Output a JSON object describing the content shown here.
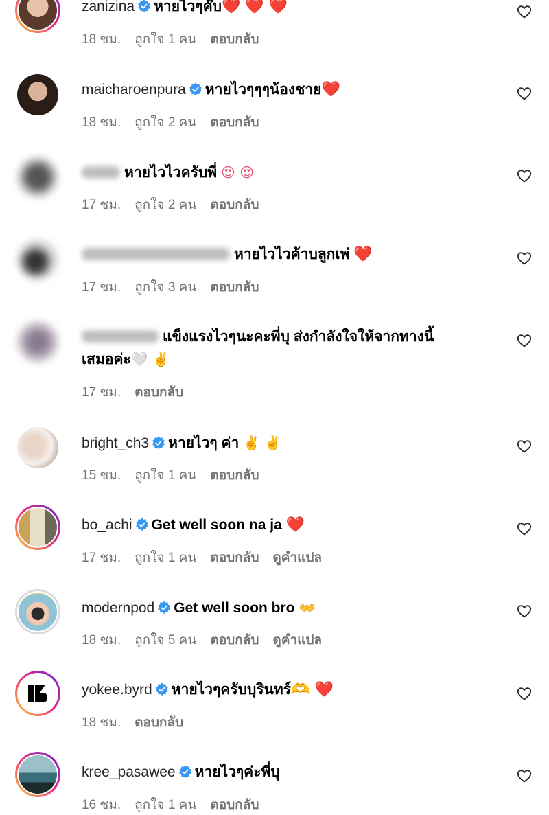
{
  "comments": [
    {
      "username": "zanizina",
      "text": "หายไวๆค๊บ",
      "emoji": "❤️ ❤️ ❤️",
      "time": "18 ชม.",
      "likes": "ถูกใจ 1 คน",
      "reply": "ตอบกลับ"
    },
    {
      "username": "maicharoenpura",
      "text": "หายไวๆๆๆน้องชาย",
      "emoji": "❤️",
      "time": "18 ชม.",
      "likes": "ถูกใจ 2 คน",
      "reply": "ตอบกลับ"
    },
    {
      "username": "",
      "text": "หายไวไวครับพี่",
      "emoji": "😍 😍",
      "time": "17 ชม.",
      "likes": "ถูกใจ 2 คน",
      "reply": "ตอบกลับ"
    },
    {
      "username": "",
      "text": "หายไวไวค้าบลูกเพ่",
      "emoji": "❤️",
      "time": "17 ชม.",
      "likes": "ถูกใจ 3 คน",
      "reply": "ตอบกลับ"
    },
    {
      "username": "",
      "text": "แข็งแรงไวๆนะคะพี่บุ ส่งกำลังใจให้จากทางนี้",
      "text2": "เสมอค่ะ",
      "emoji": "🤍 ✌️",
      "time": "17 ชม.",
      "reply": "ตอบกลับ"
    },
    {
      "username": "bright_ch3",
      "text": "หายไวๆ ค่า",
      "emoji": "✌️ ✌️",
      "time": "15 ชม.",
      "likes": "ถูกใจ 1 คน",
      "reply": "ตอบกลับ"
    },
    {
      "username": "bo_achi",
      "text": "Get well soon na ja",
      "emoji": "❤️",
      "time": "17 ชม.",
      "likes": "ถูกใจ 1 คน",
      "reply": "ตอบกลับ",
      "translate": "ดูคำแปล"
    },
    {
      "username": "modernpod",
      "text": "Get well soon bro",
      "emoji": "👐",
      "time": "18 ชม.",
      "likes": "ถูกใจ 5 คน",
      "reply": "ตอบกลับ",
      "translate": "ดูคำแปล"
    },
    {
      "username": "yokee.byrd",
      "text": "หายไวๆครับบุรินทร์",
      "emoji": "🫶 ❤️",
      "time": "18 ชม.",
      "reply": "ตอบกลับ"
    },
    {
      "username": "kree_pasawee",
      "text": "หายไวๆค่ะพี่บุ",
      "emoji": "",
      "time": "16 ชม.",
      "likes": "ถูกใจ 1 คน",
      "reply": "ตอบกลับ"
    }
  ],
  "icons": {
    "like": "heart-outline-icon",
    "verified": "verified-badge-icon"
  },
  "colors": {
    "verified": "#3897f0",
    "meta": "#737373",
    "heart": "#ef2a5c"
  }
}
